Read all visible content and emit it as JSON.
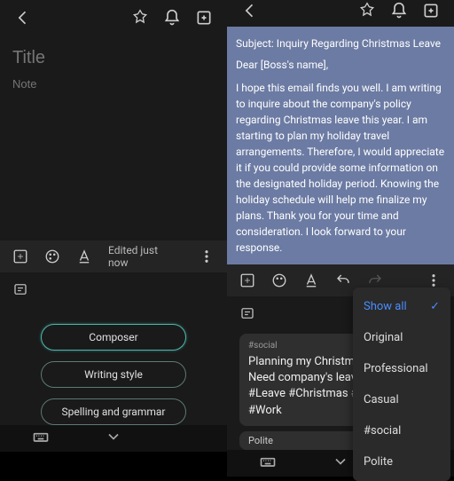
{
  "left": {
    "title_placeholder": "Title",
    "note_placeholder": "Note",
    "edited": "Edited just now",
    "pills": {
      "composer": "Composer",
      "writing_style": "Writing style",
      "spelling": "Spelling and grammar"
    }
  },
  "right": {
    "email": {
      "subject": "Subject: Inquiry Regarding Christmas Leave",
      "greeting": "Dear [Boss's name],",
      "body": "I hope this email finds you well. I am writing to inquire about the company's policy regarding Christmas leave this year.  I am starting to plan my holiday travel arrangements. Therefore, I would appreciate it if you could provide some information on the designated holiday period.  Knowing the holiday schedule will help me finalize my plans. Thank you for your time and consideration. I look forward to your response."
    },
    "card1": {
      "tag": "#social",
      "text": "Planning my Christmas travel! ✈️🎄  Need company's leave policy. #Leave #Christmas #Planning #Work"
    },
    "card2": {
      "label": "Polite"
    },
    "menu": {
      "show_all": "Show all",
      "original": "Original",
      "professional": "Professional",
      "casual": "Casual",
      "social": "#social",
      "polite": "Polite"
    }
  }
}
